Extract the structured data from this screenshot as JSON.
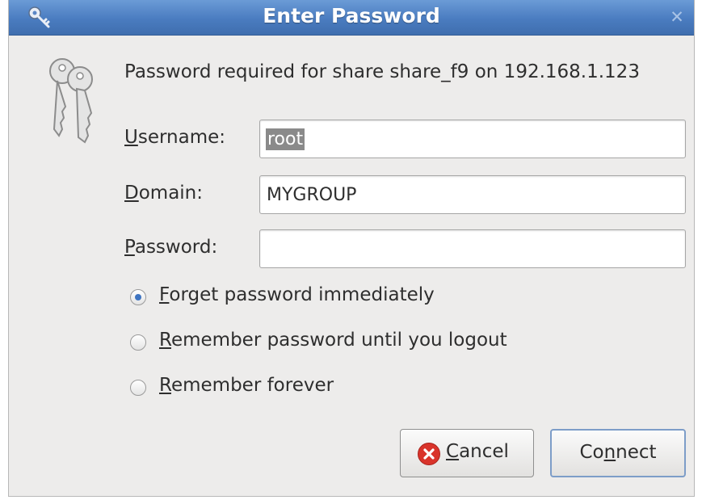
{
  "window": {
    "title": "Enter Password",
    "close_glyph": "✕",
    "title_icon": "key-icon",
    "dialog_icon": "keys-icon"
  },
  "prompt": "Password required for share share_f9 on 192.168.1.123",
  "fields": {
    "username": {
      "label_mnemonic": "U",
      "label_rest": "sername:",
      "value": "root",
      "selected": true
    },
    "domain": {
      "label_mnemonic": "D",
      "label_rest": "omain:",
      "value": "MYGROUP"
    },
    "password": {
      "label_mnemonic": "P",
      "label_rest": "assword:",
      "value": ""
    }
  },
  "remember_options": [
    {
      "mnemonic": "F",
      "rest": "orget password immediately",
      "checked": true
    },
    {
      "mnemonic": "R",
      "rest": "emember password until you logout",
      "checked": false
    },
    {
      "mnemonic": "R",
      "rest": "emember forever",
      "checked": false
    }
  ],
  "buttons": {
    "cancel": {
      "mnemonic": "C",
      "rest": "ancel",
      "icon": "cancel-icon"
    },
    "connect": {
      "pre": "Co",
      "mnemonic": "n",
      "rest": "nect"
    }
  },
  "colors": {
    "titlebar": "#4a7cc0",
    "selection": "#8a8a8a",
    "radio_dot": "#3e74c1",
    "cancel_icon": "#d9342b"
  }
}
